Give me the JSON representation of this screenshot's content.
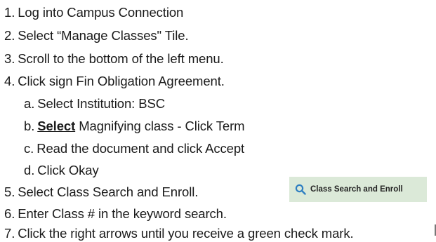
{
  "steps": [
    {
      "num": "1.",
      "text": "Log into Campus Connection"
    },
    {
      "num": "2.",
      "text": "Select “Manage Classes\" Tile."
    },
    {
      "num": "3.",
      "text": "Scroll to the bottom of the left menu."
    },
    {
      "num": "4.",
      "text": "Click sign Fin Obligation Agreement."
    },
    {
      "num": "5.",
      "text": "Select Class Search and Enroll."
    },
    {
      "num": "6.",
      "text": "Enter Class # in the keyword search."
    },
    {
      "num": "7.",
      "text": "Click the right arrows until you receive a green check mark."
    }
  ],
  "substeps": [
    {
      "letter": "a.",
      "text": "Select Institution: BSC"
    },
    {
      "letter": "b.",
      "emphasis": "Select",
      "text": " Magnifying class - Click Term"
    },
    {
      "letter": "c.",
      "text": "Read the document and click Accept"
    },
    {
      "letter": "d.",
      "text": "Click Okay"
    }
  ],
  "class_search_button": {
    "icon": "search-icon",
    "label": "Class Search and Enroll",
    "background": "#dbe9d8",
    "icon_color": "#2f7fc1"
  }
}
